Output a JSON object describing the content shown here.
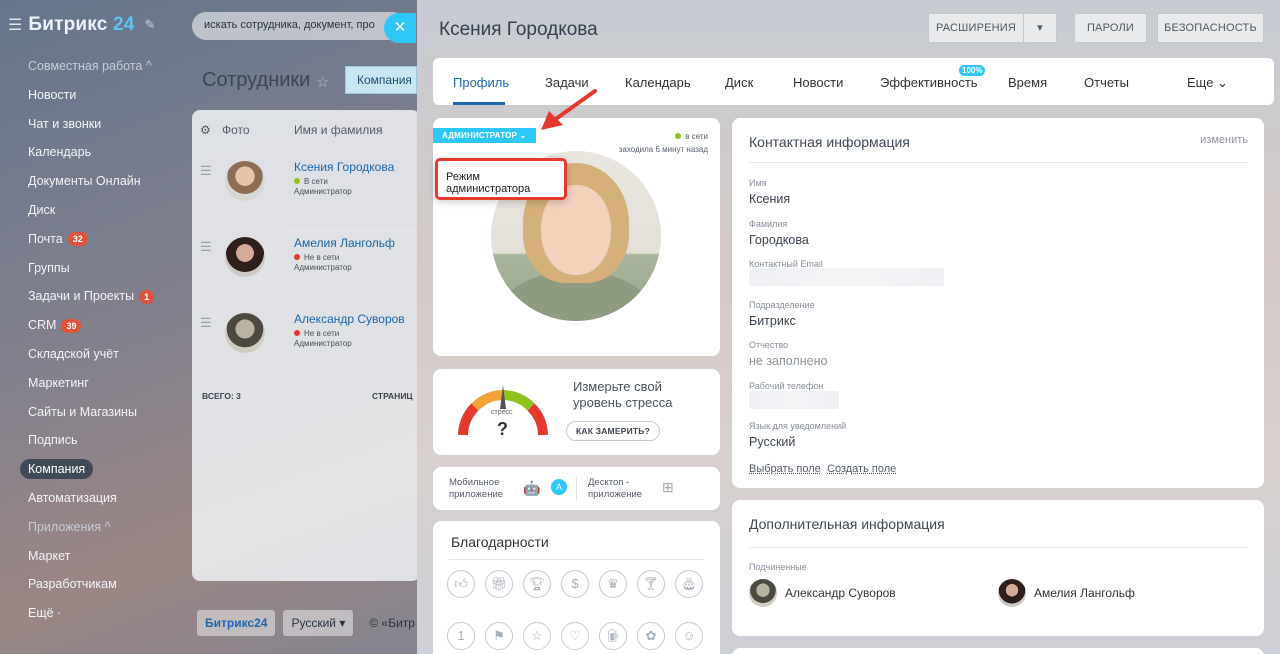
{
  "sidebar": {
    "logo": {
      "text": "Битрикс",
      "num": "24"
    },
    "items": [
      {
        "label": "Совместная работа ^",
        "group": true
      },
      {
        "label": "Новости"
      },
      {
        "label": "Чат и звонки"
      },
      {
        "label": "Календарь"
      },
      {
        "label": "Документы Онлайн"
      },
      {
        "label": "Диск"
      },
      {
        "label": "Почта",
        "badge": "32"
      },
      {
        "label": "Группы"
      },
      {
        "label": "Задачи и Проекты",
        "badge": "1"
      },
      {
        "label": "CRM",
        "badge": "39"
      },
      {
        "label": "Складской учёт"
      },
      {
        "label": "Маркетинг"
      },
      {
        "label": "Сайты и Магазины"
      },
      {
        "label": "Подпись"
      },
      {
        "label": "Компания",
        "active": true
      },
      {
        "label": "Автоматизация"
      },
      {
        "label": "Приложения ^",
        "group": true
      },
      {
        "label": "Маркет"
      },
      {
        "label": "Разработчикам"
      },
      {
        "label": "Ещё ·"
      }
    ]
  },
  "search": {
    "placeholder": "искать сотрудника, документ, про"
  },
  "employees": {
    "title": "Сотрудники",
    "company_button": "Компания",
    "col_photo": "Фото",
    "col_name": "Имя и фамилия",
    "rows": [
      {
        "name": "Ксения Городкова",
        "status": "В сети",
        "status_color": "#8fc21f",
        "role": "Администратор"
      },
      {
        "name": "Амелия Лангольф",
        "status": "Не в сети",
        "status_color": "#e5392d",
        "role": "Администратор"
      },
      {
        "name": "Александр Суворов",
        "status": "Не в сети",
        "status_color": "#e5392d",
        "role": "Администратор"
      }
    ],
    "total": "ВСЕГО: 3",
    "pages": "СТРАНИЦ"
  },
  "footer": {
    "brand": "Битрикс24",
    "lang": "Русский ▾",
    "copy": "© «Битр"
  },
  "profile": {
    "name": "Ксения Городкова",
    "buttons": {
      "extensions": "РАСШИРЕНИЯ",
      "passwords": "ПАРОЛИ",
      "security": "БЕЗОПАСНОСТЬ"
    },
    "tabs": [
      "Профиль",
      "Задачи",
      "Календарь",
      "Диск",
      "Новости",
      "Эффективность",
      "Время",
      "Отчеты",
      "Еще"
    ],
    "efficiency_badge": "100%",
    "admin_badge": "АДМИНИСТРАТОР",
    "online": "в сети",
    "last_seen": "заходила 6 минут назад",
    "admin_mode": "Режим администратора",
    "stress": {
      "label": "Измерьте свой уровень стресса",
      "gauge_label": "стресс",
      "value": "?",
      "button": "КАК ЗАМЕРИТЬ?"
    },
    "apps": {
      "mobile": "Мобильное приложение",
      "desktop": "Десктоп - приложение"
    },
    "thanks_title": "Благодарности",
    "contact": {
      "title": "Контактная информация",
      "edit": "изменить",
      "fields": [
        {
          "label": "Имя",
          "value": "Ксения"
        },
        {
          "label": "Фамилия",
          "value": "Городкова"
        },
        {
          "label": "Контактный Email",
          "value": ""
        },
        {
          "label": "Подразделение",
          "value": "Битрикс"
        },
        {
          "label": "Отчество",
          "value": "не заполнено"
        },
        {
          "label": "Рабочий телефон",
          "value": ""
        },
        {
          "label": "Язык для уведомлений",
          "value": "Русский"
        }
      ],
      "choose_field": "Выбрать поле",
      "create_field": "Создать поле"
    },
    "additional": {
      "title": "Дополнительная информация",
      "subordinates_label": "Подчиненные",
      "subordinates": [
        "Александр Суворов",
        "Амелия Лангольф"
      ]
    }
  }
}
